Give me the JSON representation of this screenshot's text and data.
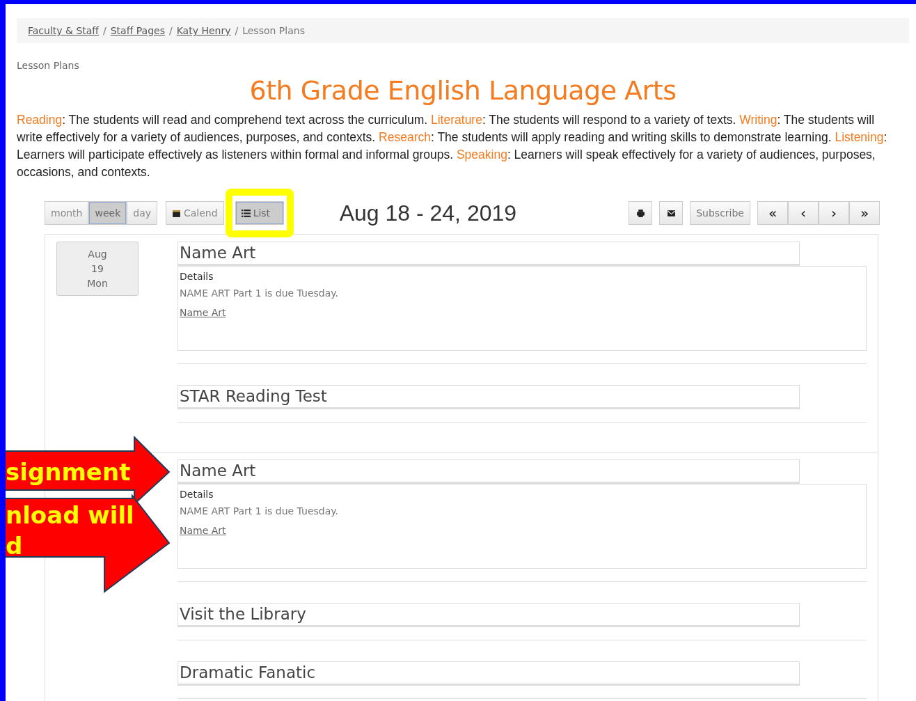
{
  "breadcrumb": {
    "links": [
      "Faculty & Staff",
      "Staff Pages",
      "Katy Henry"
    ],
    "separator": "/",
    "current": "Lesson Plans"
  },
  "section_label": "Lesson Plans",
  "title": "6th Grade English Language Arts",
  "standards": [
    {
      "term": "Reading",
      "text": ": The students will read and comprehend text across the curriculum. "
    },
    {
      "term": "Literature",
      "text": ": The students will respond to a variety of texts. "
    },
    {
      "term": "Writing",
      "text": ": The students will write effectively for a variety of audiences, purposes, and contexts. "
    },
    {
      "term": "Research",
      "text": ": The students will apply reading and writing skills to demonstrate learning. "
    },
    {
      "term": "Listening",
      "text": ": Learners will participate effectively as listeners within formal and informal groups. "
    },
    {
      "term": "Speaking",
      "text": ": Learners will speak effectively for a variety of audiences, purposes, occasions, and contexts."
    }
  ],
  "toolbar": {
    "range_views": [
      {
        "label": "month",
        "selected": false
      },
      {
        "label": "week",
        "selected": true
      },
      {
        "label": "day",
        "selected": false
      }
    ],
    "display_views": [
      {
        "kind": "calendar",
        "label": "Calend",
        "selected": false
      },
      {
        "kind": "list",
        "label": "List",
        "selected": true
      }
    ],
    "date_range": "Aug 18 - 24, 2019",
    "actions": [
      {
        "kind": "print"
      },
      {
        "kind": "email"
      },
      {
        "kind": "text",
        "label": "Subscribe"
      }
    ],
    "nav": [
      "«",
      "‹",
      "›",
      "»"
    ]
  },
  "days": [
    {
      "month": "Aug",
      "day": "19",
      "weekday": "Mon",
      "events": [
        {
          "title": "Name Art",
          "details_label": "Details",
          "details": "NAME ART Part 1 is due Tuesday.",
          "link": "Name Art"
        },
        {
          "title": "STAR Reading Test"
        }
      ]
    },
    {
      "events": [
        {
          "title": "Name Art",
          "details_label": "Details",
          "details": "NAME ART Part 1 is due Tuesday.",
          "link": "Name Art"
        },
        {
          "title": "Visit the Library"
        },
        {
          "title": "Dramatic Fanatic"
        }
      ]
    }
  ],
  "callouts": [
    "signment",
    "nload will",
    "d"
  ]
}
